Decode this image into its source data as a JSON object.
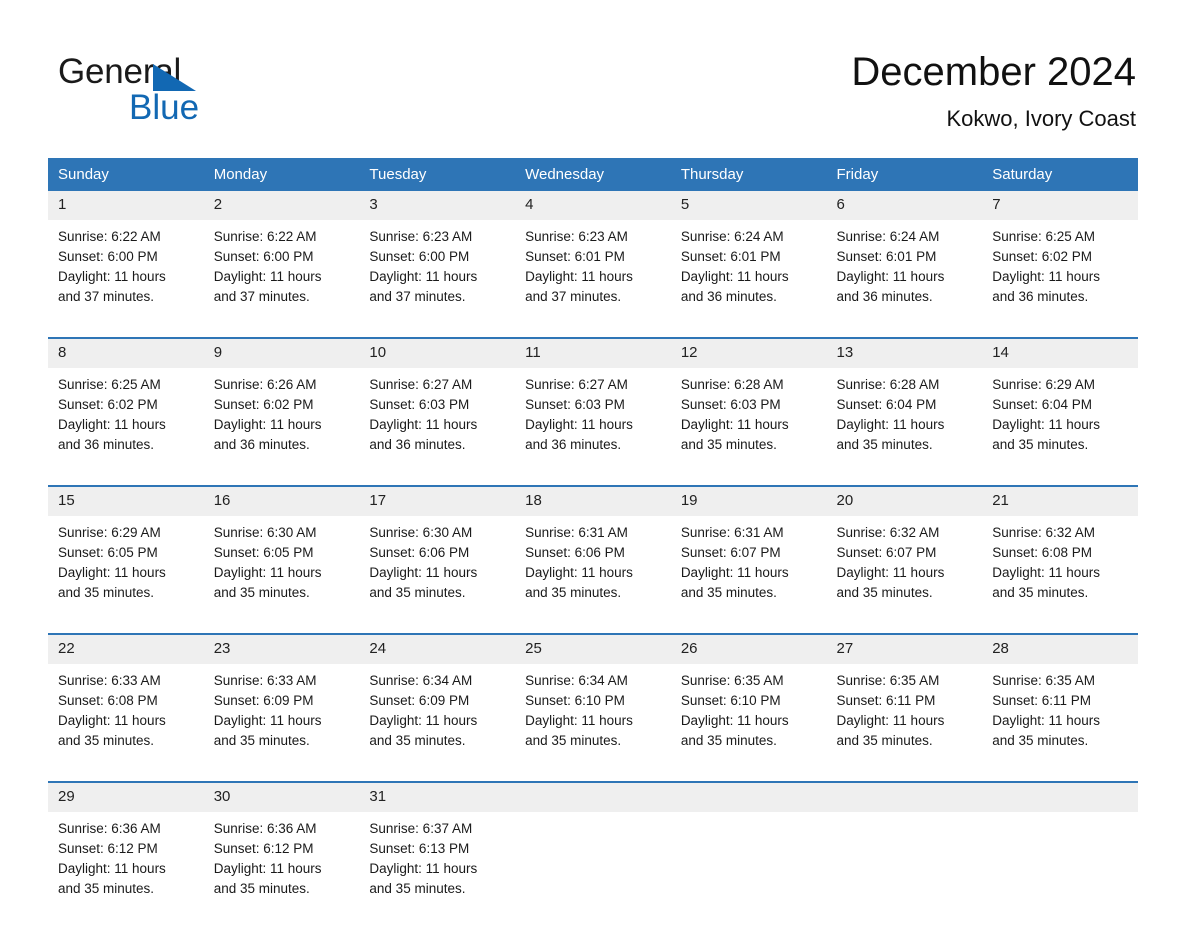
{
  "brand": {
    "name_part1": "General",
    "name_part2": "Blue",
    "triangle_color": "#1268b3"
  },
  "header": {
    "month_title": "December 2024",
    "location": "Kokwo, Ivory Coast"
  },
  "colors": {
    "header_blue": "#2e75b6",
    "daynum_band": "#efefef",
    "text": "#1a1a1a"
  },
  "weekday_headers": [
    "Sunday",
    "Monday",
    "Tuesday",
    "Wednesday",
    "Thursday",
    "Friday",
    "Saturday"
  ],
  "weeks": [
    {
      "days": [
        {
          "date": "1",
          "sunrise": "Sunrise: 6:22 AM",
          "sunset": "Sunset: 6:00 PM",
          "daylight_line1": "Daylight: 11 hours",
          "daylight_line2": "and 37 minutes."
        },
        {
          "date": "2",
          "sunrise": "Sunrise: 6:22 AM",
          "sunset": "Sunset: 6:00 PM",
          "daylight_line1": "Daylight: 11 hours",
          "daylight_line2": "and 37 minutes."
        },
        {
          "date": "3",
          "sunrise": "Sunrise: 6:23 AM",
          "sunset": "Sunset: 6:00 PM",
          "daylight_line1": "Daylight: 11 hours",
          "daylight_line2": "and 37 minutes."
        },
        {
          "date": "4",
          "sunrise": "Sunrise: 6:23 AM",
          "sunset": "Sunset: 6:01 PM",
          "daylight_line1": "Daylight: 11 hours",
          "daylight_line2": "and 37 minutes."
        },
        {
          "date": "5",
          "sunrise": "Sunrise: 6:24 AM",
          "sunset": "Sunset: 6:01 PM",
          "daylight_line1": "Daylight: 11 hours",
          "daylight_line2": "and 36 minutes."
        },
        {
          "date": "6",
          "sunrise": "Sunrise: 6:24 AM",
          "sunset": "Sunset: 6:01 PM",
          "daylight_line1": "Daylight: 11 hours",
          "daylight_line2": "and 36 minutes."
        },
        {
          "date": "7",
          "sunrise": "Sunrise: 6:25 AM",
          "sunset": "Sunset: 6:02 PM",
          "daylight_line1": "Daylight: 11 hours",
          "daylight_line2": "and 36 minutes."
        }
      ]
    },
    {
      "days": [
        {
          "date": "8",
          "sunrise": "Sunrise: 6:25 AM",
          "sunset": "Sunset: 6:02 PM",
          "daylight_line1": "Daylight: 11 hours",
          "daylight_line2": "and 36 minutes."
        },
        {
          "date": "9",
          "sunrise": "Sunrise: 6:26 AM",
          "sunset": "Sunset: 6:02 PM",
          "daylight_line1": "Daylight: 11 hours",
          "daylight_line2": "and 36 minutes."
        },
        {
          "date": "10",
          "sunrise": "Sunrise: 6:27 AM",
          "sunset": "Sunset: 6:03 PM",
          "daylight_line1": "Daylight: 11 hours",
          "daylight_line2": "and 36 minutes."
        },
        {
          "date": "11",
          "sunrise": "Sunrise: 6:27 AM",
          "sunset": "Sunset: 6:03 PM",
          "daylight_line1": "Daylight: 11 hours",
          "daylight_line2": "and 36 minutes."
        },
        {
          "date": "12",
          "sunrise": "Sunrise: 6:28 AM",
          "sunset": "Sunset: 6:03 PM",
          "daylight_line1": "Daylight: 11 hours",
          "daylight_line2": "and 35 minutes."
        },
        {
          "date": "13",
          "sunrise": "Sunrise: 6:28 AM",
          "sunset": "Sunset: 6:04 PM",
          "daylight_line1": "Daylight: 11 hours",
          "daylight_line2": "and 35 minutes."
        },
        {
          "date": "14",
          "sunrise": "Sunrise: 6:29 AM",
          "sunset": "Sunset: 6:04 PM",
          "daylight_line1": "Daylight: 11 hours",
          "daylight_line2": "and 35 minutes."
        }
      ]
    },
    {
      "days": [
        {
          "date": "15",
          "sunrise": "Sunrise: 6:29 AM",
          "sunset": "Sunset: 6:05 PM",
          "daylight_line1": "Daylight: 11 hours",
          "daylight_line2": "and 35 minutes."
        },
        {
          "date": "16",
          "sunrise": "Sunrise: 6:30 AM",
          "sunset": "Sunset: 6:05 PM",
          "daylight_line1": "Daylight: 11 hours",
          "daylight_line2": "and 35 minutes."
        },
        {
          "date": "17",
          "sunrise": "Sunrise: 6:30 AM",
          "sunset": "Sunset: 6:06 PM",
          "daylight_line1": "Daylight: 11 hours",
          "daylight_line2": "and 35 minutes."
        },
        {
          "date": "18",
          "sunrise": "Sunrise: 6:31 AM",
          "sunset": "Sunset: 6:06 PM",
          "daylight_line1": "Daylight: 11 hours",
          "daylight_line2": "and 35 minutes."
        },
        {
          "date": "19",
          "sunrise": "Sunrise: 6:31 AM",
          "sunset": "Sunset: 6:07 PM",
          "daylight_line1": "Daylight: 11 hours",
          "daylight_line2": "and 35 minutes."
        },
        {
          "date": "20",
          "sunrise": "Sunrise: 6:32 AM",
          "sunset": "Sunset: 6:07 PM",
          "daylight_line1": "Daylight: 11 hours",
          "daylight_line2": "and 35 minutes."
        },
        {
          "date": "21",
          "sunrise": "Sunrise: 6:32 AM",
          "sunset": "Sunset: 6:08 PM",
          "daylight_line1": "Daylight: 11 hours",
          "daylight_line2": "and 35 minutes."
        }
      ]
    },
    {
      "days": [
        {
          "date": "22",
          "sunrise": "Sunrise: 6:33 AM",
          "sunset": "Sunset: 6:08 PM",
          "daylight_line1": "Daylight: 11 hours",
          "daylight_line2": "and 35 minutes."
        },
        {
          "date": "23",
          "sunrise": "Sunrise: 6:33 AM",
          "sunset": "Sunset: 6:09 PM",
          "daylight_line1": "Daylight: 11 hours",
          "daylight_line2": "and 35 minutes."
        },
        {
          "date": "24",
          "sunrise": "Sunrise: 6:34 AM",
          "sunset": "Sunset: 6:09 PM",
          "daylight_line1": "Daylight: 11 hours",
          "daylight_line2": "and 35 minutes."
        },
        {
          "date": "25",
          "sunrise": "Sunrise: 6:34 AM",
          "sunset": "Sunset: 6:10 PM",
          "daylight_line1": "Daylight: 11 hours",
          "daylight_line2": "and 35 minutes."
        },
        {
          "date": "26",
          "sunrise": "Sunrise: 6:35 AM",
          "sunset": "Sunset: 6:10 PM",
          "daylight_line1": "Daylight: 11 hours",
          "daylight_line2": "and 35 minutes."
        },
        {
          "date": "27",
          "sunrise": "Sunrise: 6:35 AM",
          "sunset": "Sunset: 6:11 PM",
          "daylight_line1": "Daylight: 11 hours",
          "daylight_line2": "and 35 minutes."
        },
        {
          "date": "28",
          "sunrise": "Sunrise: 6:35 AM",
          "sunset": "Sunset: 6:11 PM",
          "daylight_line1": "Daylight: 11 hours",
          "daylight_line2": "and 35 minutes."
        }
      ]
    },
    {
      "days": [
        {
          "date": "29",
          "sunrise": "Sunrise: 6:36 AM",
          "sunset": "Sunset: 6:12 PM",
          "daylight_line1": "Daylight: 11 hours",
          "daylight_line2": "and 35 minutes."
        },
        {
          "date": "30",
          "sunrise": "Sunrise: 6:36 AM",
          "sunset": "Sunset: 6:12 PM",
          "daylight_line1": "Daylight: 11 hours",
          "daylight_line2": "and 35 minutes."
        },
        {
          "date": "31",
          "sunrise": "Sunrise: 6:37 AM",
          "sunset": "Sunset: 6:13 PM",
          "daylight_line1": "Daylight: 11 hours",
          "daylight_line2": "and 35 minutes."
        },
        {
          "date": "",
          "sunrise": "",
          "sunset": "",
          "daylight_line1": "",
          "daylight_line2": ""
        },
        {
          "date": "",
          "sunrise": "",
          "sunset": "",
          "daylight_line1": "",
          "daylight_line2": ""
        },
        {
          "date": "",
          "sunrise": "",
          "sunset": "",
          "daylight_line1": "",
          "daylight_line2": ""
        },
        {
          "date": "",
          "sunrise": "",
          "sunset": "",
          "daylight_line1": "",
          "daylight_line2": ""
        }
      ]
    }
  ]
}
